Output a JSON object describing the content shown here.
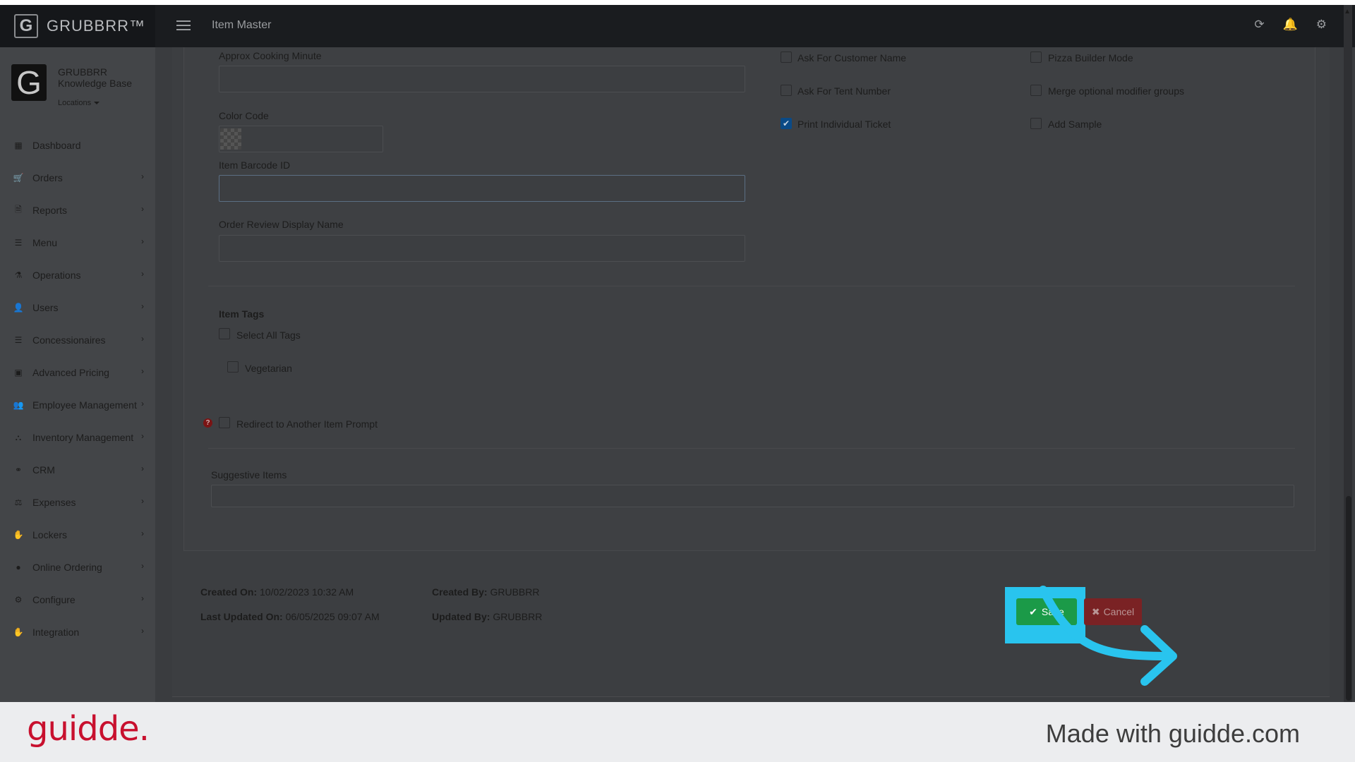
{
  "brand": {
    "logo_letter": "G",
    "name": "GRUBBRR™"
  },
  "account": {
    "name_line1": "GRUBBRR",
    "name_line2": "Knowledge Base",
    "locations": "Locations"
  },
  "sidebar": {
    "items": [
      {
        "label": "Dashboard",
        "icon": "dashboard-icon",
        "glyph": "▦",
        "chevron": false
      },
      {
        "label": "Orders",
        "icon": "cart-icon",
        "glyph": "🛒",
        "chevron": true
      },
      {
        "label": "Reports",
        "icon": "report-icon",
        "glyph": "🗎",
        "chevron": true
      },
      {
        "label": "Menu",
        "icon": "menu-list-icon",
        "glyph": "☰",
        "chevron": true
      },
      {
        "label": "Operations",
        "icon": "flask-icon",
        "glyph": "⚗",
        "chevron": true
      },
      {
        "label": "Users",
        "icon": "user-add-icon",
        "glyph": "👤",
        "chevron": true
      },
      {
        "label": "Concessionaires",
        "icon": "list-icon",
        "glyph": "☰",
        "chevron": true
      },
      {
        "label": "Advanced Pricing",
        "icon": "money-icon",
        "glyph": "▣",
        "chevron": true
      },
      {
        "label": "Employee Management",
        "icon": "users-icon",
        "glyph": "👥",
        "chevron": true
      },
      {
        "label": "Inventory Management",
        "icon": "sitemap-icon",
        "glyph": "⛬",
        "chevron": true
      },
      {
        "label": "CRM",
        "icon": "link-icon",
        "glyph": "⚭",
        "chevron": true
      },
      {
        "label": "Expenses",
        "icon": "scale-icon",
        "glyph": "⚖",
        "chevron": true
      },
      {
        "label": "Lockers",
        "icon": "hand-icon",
        "glyph": "✋",
        "chevron": true
      },
      {
        "label": "Online Ordering",
        "icon": "globe-icon",
        "glyph": "●",
        "chevron": true
      },
      {
        "label": "Configure",
        "icon": "gear-icon",
        "glyph": "⚙",
        "chevron": true
      },
      {
        "label": "Integration",
        "icon": "hand-icon",
        "glyph": "✋",
        "chevron": true
      }
    ]
  },
  "header": {
    "title": "Item Master"
  },
  "form": {
    "approx_cooking_label": "Approx Cooking Minute",
    "approx_cooking_value": "",
    "color_code_label": "Color Code",
    "barcode_label": "Item Barcode ID",
    "barcode_value": "",
    "order_review_label": "Order Review Display Name",
    "order_review_value": "",
    "checkboxes_col1": [
      {
        "label": "Ask For Customer Name",
        "checked": false
      },
      {
        "label": "Ask For Tent Number",
        "checked": false
      },
      {
        "label": "Print Individual Ticket",
        "checked": true
      }
    ],
    "checkboxes_col2": [
      {
        "label": "Pizza Builder Mode",
        "checked": false
      },
      {
        "label": "Merge optional modifier groups",
        "checked": false
      },
      {
        "label": "Add Sample",
        "checked": false
      }
    ],
    "item_tags_title": "Item Tags",
    "select_all_tags": "Select All Tags",
    "tag_vegetarian": "Vegetarian",
    "redirect_label": "Redirect to Another Item Prompt",
    "suggestive_label": "Suggestive Items",
    "suggestive_value": ""
  },
  "meta": {
    "created_on_label": "Created On:",
    "created_on_value": "10/02/2023 10:32 AM",
    "last_updated_label": "Last Updated On:",
    "last_updated_value": "06/05/2025 09:07 AM",
    "created_by_label": "Created By:",
    "created_by_value": "GRUBBRR",
    "updated_by_label": "Updated By:",
    "updated_by_value": "GRUBBRR"
  },
  "actions": {
    "save_label": "Save",
    "cancel_label": "Cancel"
  },
  "colors": {
    "highlight": "#29c4ee",
    "save": "#1b9a48",
    "cancel": "#7a2224",
    "guidde_red": "#c8102e"
  },
  "footer": {
    "logo": "guidde.",
    "made_with": "Made with guidde.com"
  }
}
